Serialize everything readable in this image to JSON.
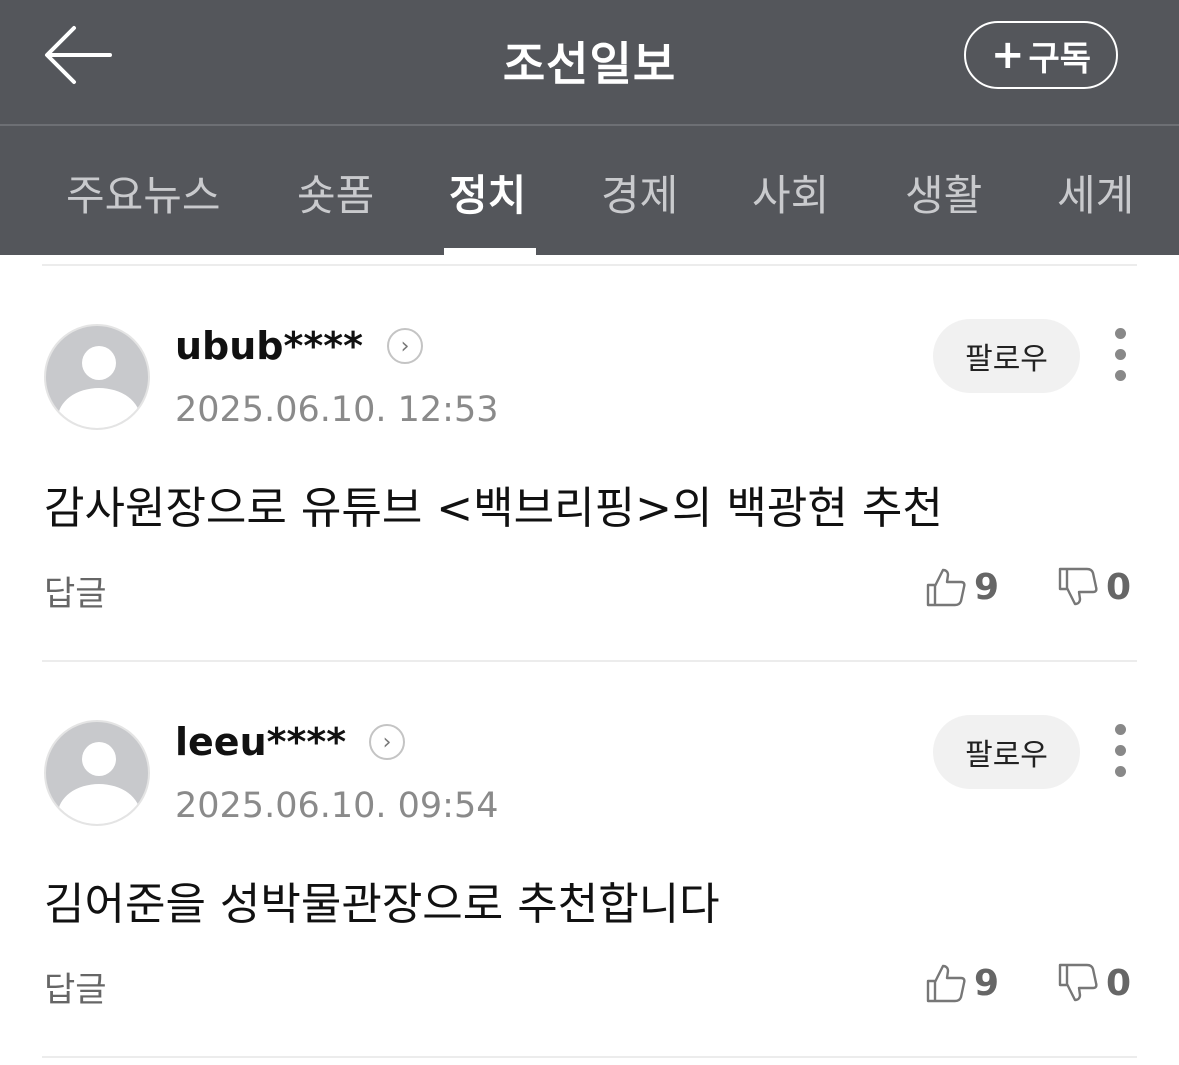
{
  "header": {
    "title": "조선일보",
    "subscribe_label": "구독",
    "subscribe_icon": "plus-icon",
    "back_icon": "arrow-left-icon"
  },
  "tabs": [
    {
      "label": "주요뉴스",
      "active": false
    },
    {
      "label": "숏폼",
      "active": false
    },
    {
      "label": "정치",
      "active": true
    },
    {
      "label": "경제",
      "active": false
    },
    {
      "label": "사회",
      "active": false
    },
    {
      "label": "생활",
      "active": false
    },
    {
      "label": "세계",
      "active": false
    }
  ],
  "comments": [
    {
      "username": "ubub****",
      "date": "2025.06.10. 12:53",
      "follow_label": "팔로우",
      "text": "감사원장으로 유튜브 <백브리핑>의 백광현 추천",
      "reply_label": "답글",
      "likes": "9",
      "dislikes": "0"
    },
    {
      "username": "leeu****",
      "date": "2025.06.10. 09:54",
      "follow_label": "팔로우",
      "text": "김어준을 성박물관장으로 추천합니다",
      "reply_label": "답글",
      "likes": "9",
      "dislikes": "0"
    }
  ],
  "colors": {
    "header_bg": "#54565b",
    "tab_inactive": "#c9cacd",
    "tab_active": "#ffffff"
  }
}
